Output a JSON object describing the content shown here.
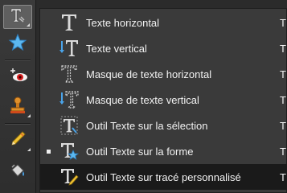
{
  "toolbar": {
    "tools": [
      {
        "name": "type-tool",
        "icon": "type-t-icon",
        "active": true
      },
      {
        "name": "shape-tool",
        "icon": "star-shape-icon",
        "active": false
      },
      {
        "name": "red-eye-tool",
        "icon": "red-eye-icon",
        "active": false
      },
      {
        "name": "clone-stamp-tool",
        "icon": "stamp-icon",
        "active": false
      },
      {
        "name": "pencil-tool",
        "icon": "pencil-icon",
        "active": false
      },
      {
        "name": "paint-bucket-tool",
        "icon": "paint-bucket-icon",
        "active": false
      }
    ]
  },
  "menu": {
    "items": [
      {
        "label": "Texte horizontal",
        "icon": "horizontal-type-icon",
        "shortcut": "T",
        "selected": false,
        "highlighted": false
      },
      {
        "label": "Texte vertical",
        "icon": "vertical-type-icon",
        "shortcut": "T",
        "selected": false,
        "highlighted": false
      },
      {
        "label": "Masque de texte horizontal",
        "icon": "horizontal-type-mask-icon",
        "shortcut": "T",
        "selected": false,
        "highlighted": false
      },
      {
        "label": "Masque de texte vertical",
        "icon": "vertical-type-mask-icon",
        "shortcut": "T",
        "selected": false,
        "highlighted": false
      },
      {
        "label": "Outil Texte sur la sélection",
        "icon": "text-on-selection-icon",
        "shortcut": "T",
        "selected": false,
        "highlighted": false
      },
      {
        "label": "Outil Texte sur la forme",
        "icon": "text-on-shape-icon",
        "shortcut": "T",
        "selected": true,
        "highlighted": false
      },
      {
        "label": "Outil Texte sur tracé personnalisé",
        "icon": "text-on-path-icon",
        "shortcut": "T",
        "selected": false,
        "highlighted": true
      }
    ]
  },
  "colors": {
    "menu_bg": "#3a3a3a",
    "highlight_bg": "#1a1a1a",
    "text": "#f2f2f2",
    "vertical_accent": "#4aa3e8"
  }
}
